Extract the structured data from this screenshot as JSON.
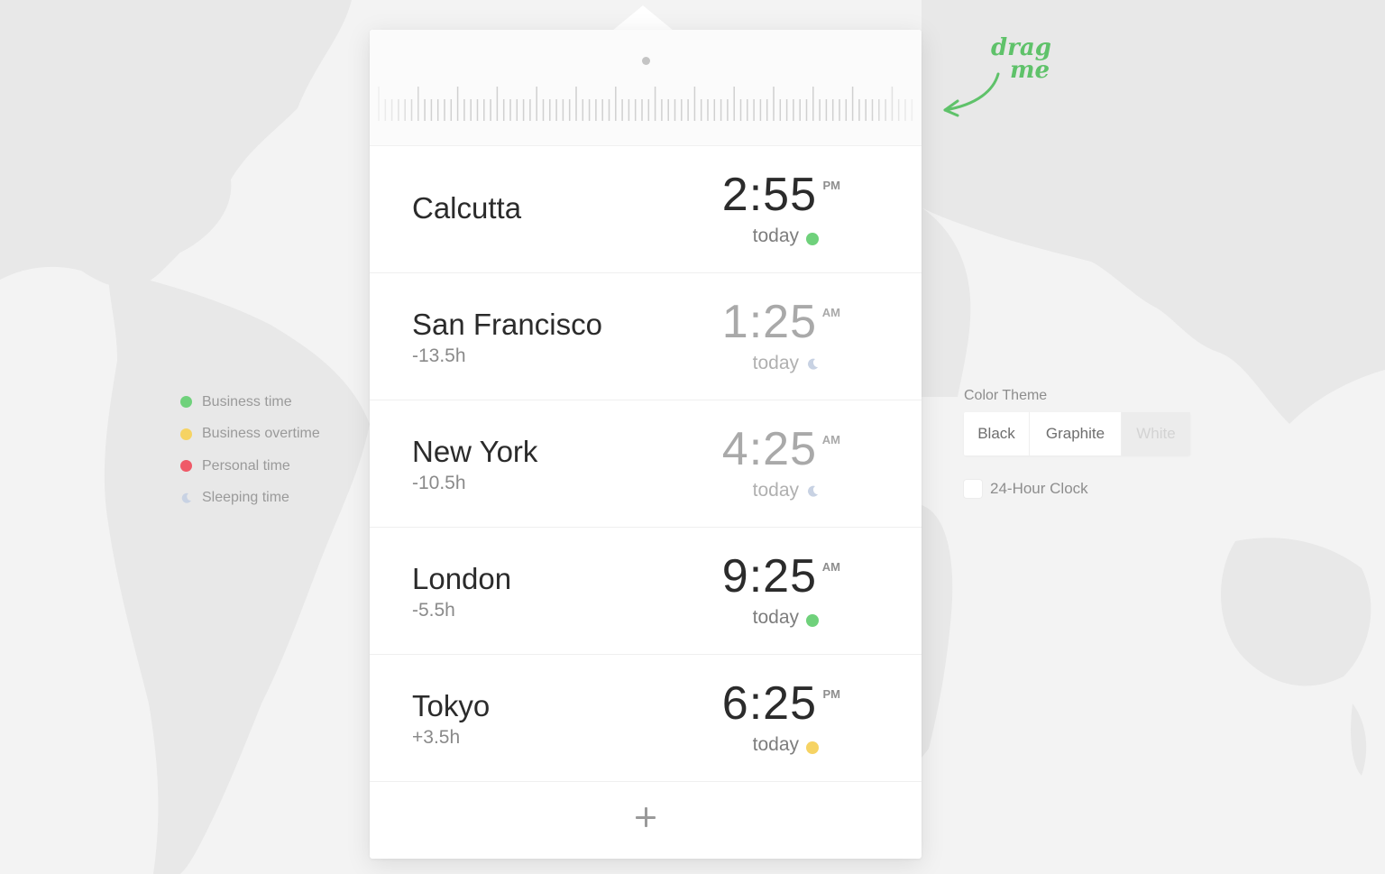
{
  "legend": {
    "items": [
      {
        "label": "Business time",
        "color": "#6fd17b",
        "kind": "dot"
      },
      {
        "label": "Business overtime",
        "color": "#f6d363",
        "kind": "dot"
      },
      {
        "label": "Personal time",
        "color": "#ef5a68",
        "kind": "dot"
      },
      {
        "label": "Sleeping time",
        "color": "#c8d2e3",
        "kind": "moon"
      }
    ]
  },
  "cities": [
    {
      "name": "Calcutta",
      "offset": "",
      "time": "2:55",
      "ampm": "PM",
      "day": "today",
      "status": "business",
      "status_color": "#6fd17b"
    },
    {
      "name": "San Francisco",
      "offset": "-13.5h",
      "time": "1:25",
      "ampm": "AM",
      "day": "today",
      "status": "sleeping",
      "status_color": "#c8d2e3"
    },
    {
      "name": "New York",
      "offset": "-10.5h",
      "time": "4:25",
      "ampm": "AM",
      "day": "today",
      "status": "sleeping",
      "status_color": "#c8d2e3"
    },
    {
      "name": "London",
      "offset": "-5.5h",
      "time": "9:25",
      "ampm": "AM",
      "day": "today",
      "status": "business",
      "status_color": "#6fd17b"
    },
    {
      "name": "Tokyo",
      "offset": "+3.5h",
      "time": "6:25",
      "ampm": "PM",
      "day": "today",
      "status": "overtime",
      "status_color": "#f6d363"
    }
  ],
  "drag_hint": {
    "line1": "drag",
    "line2": "me",
    "color": "#5fc26a"
  },
  "settings": {
    "color_theme_title": "Color Theme",
    "themes": [
      "Black",
      "Graphite",
      "White"
    ],
    "selected_theme": "White",
    "clock_label": "24-Hour Clock"
  },
  "icons": {
    "add": "plus-icon",
    "moon": "moon-icon",
    "arrow": "curved-arrow-icon"
  }
}
